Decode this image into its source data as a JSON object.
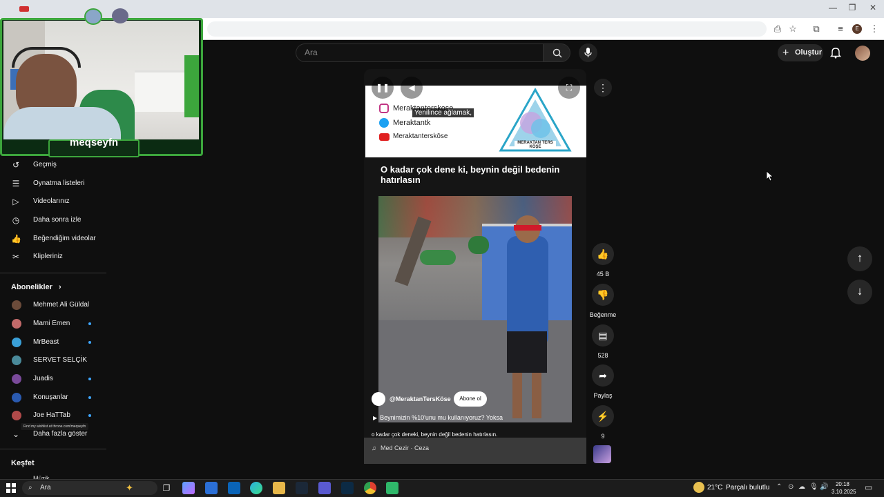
{
  "browser": {
    "window_controls": [
      "—",
      "❐",
      "✕"
    ]
  },
  "youtube": {
    "search_placeholder": "Ara",
    "create_label": "Oluştur"
  },
  "webcam": {
    "streamer_name": "meqseyfn"
  },
  "sidebar": {
    "you_items": [
      {
        "label": "Geçmiş",
        "icon": "history-icon"
      },
      {
        "label": "Oynatma listeleri",
        "icon": "playlist-icon"
      },
      {
        "label": "Videolarınız",
        "icon": "video-icon"
      },
      {
        "label": "Daha sonra izle",
        "icon": "clock-icon"
      },
      {
        "label": "Beğendiğim videolar",
        "icon": "thumbs-up-icon"
      },
      {
        "label": "Klipleriniz",
        "icon": "scissors-icon"
      }
    ],
    "subscriptions_heading": "Abonelikler",
    "subscriptions": [
      {
        "name": "Mehmet Ali Güldal",
        "new": false,
        "color": "#6b4b3a"
      },
      {
        "name": "Mami Emen",
        "new": true,
        "color": "#c26a6a"
      },
      {
        "name": "MrBeast",
        "new": true,
        "color": "#3aa0d8"
      },
      {
        "name": "SERVET SELÇİK",
        "new": false,
        "color": "#4a8a9a"
      },
      {
        "name": "Juadis",
        "new": true,
        "color": "#7a4a9a"
      },
      {
        "name": "Konuşanlar",
        "new": true,
        "color": "#2a5ab0"
      },
      {
        "name": "Joe HaTTab",
        "new": true,
        "color": "#b04a4a"
      }
    ],
    "show_more": "Daha fazla göster",
    "tooltip": "Find my wishlist at throne.com/meqseyfn",
    "explore_heading": "Keşfet",
    "explore_partial": "Müzik"
  },
  "short": {
    "overlay_caption": "Yenilince ağlamak,",
    "social_lines": [
      "Meraktanterskose",
      "Meraktantk",
      "Meraktanterskōse"
    ],
    "logo_text": "MERAKTAN TERS KÖŞE",
    "title": "O kadar çok dene ki, beynin değil bedenin hatırlasın",
    "channel": "@MeraktanTersKöse",
    "subscribe_label": "Abone ol",
    "linked_video": "Beynimizin %10'unu mu kullanıyoruz? Yoksa",
    "description": "o kadar çok deneki, beynin değil bedenin hatırlasın.",
    "music": "Med Cezir · Ceza"
  },
  "actions": {
    "likes": "45 B",
    "dislike_label": "Beğenme",
    "comments": "528",
    "share_label": "Paylaş",
    "remix_count": "9"
  },
  "taskbar": {
    "search_placeholder": "Ara",
    "weather": "21°C",
    "weather_desc": "Parçalı bulutlu",
    "time": "20:18",
    "date": "3.10.2025"
  }
}
